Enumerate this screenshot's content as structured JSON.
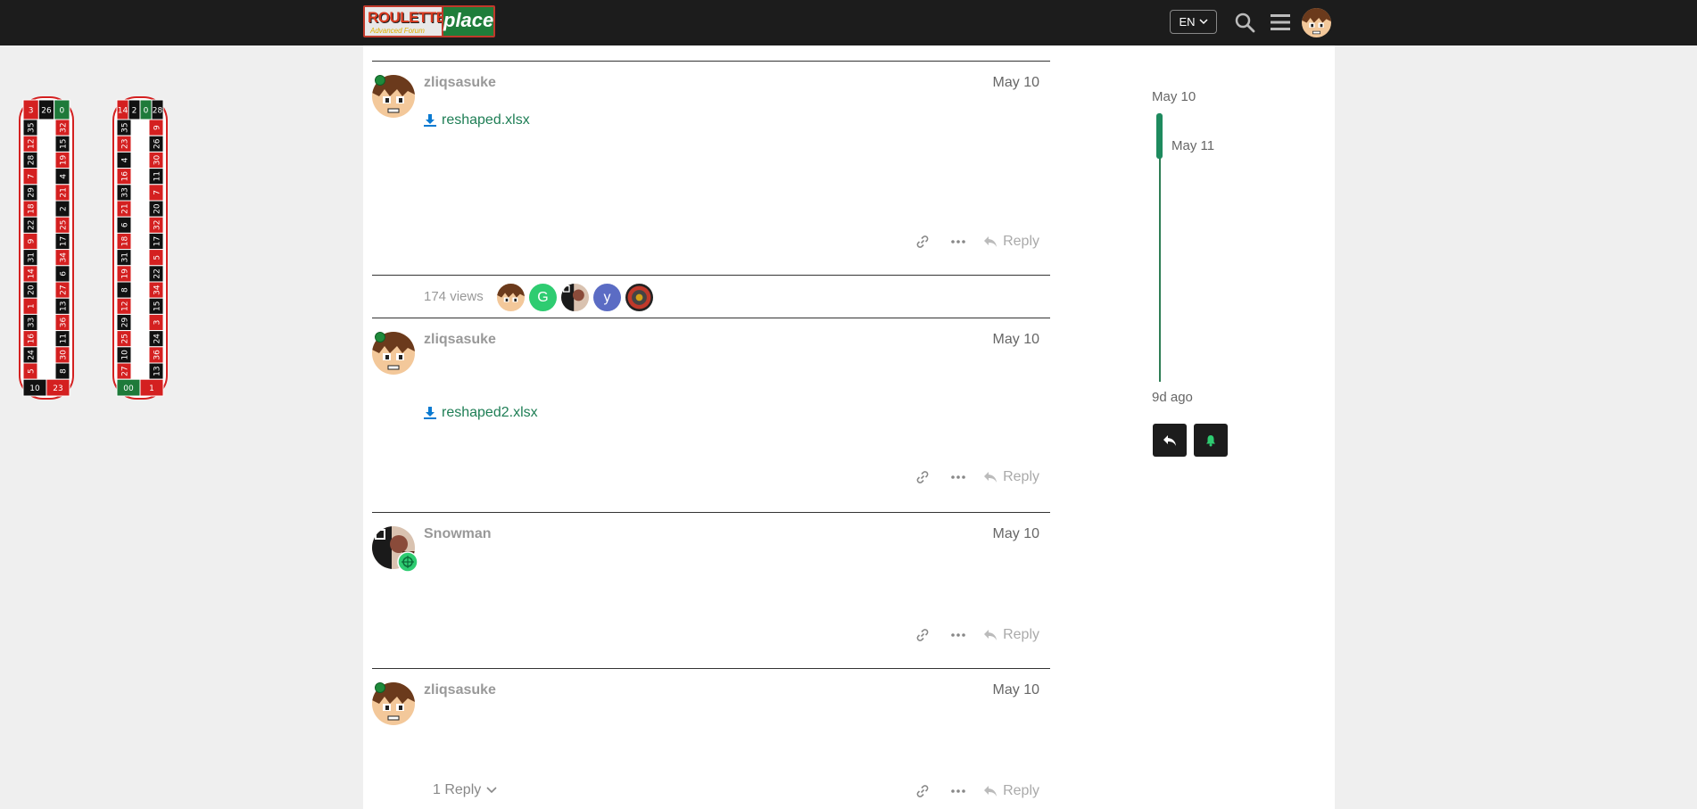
{
  "header": {
    "logo": {
      "word1": "ROULETTE",
      "word2": "place",
      "tagline": "Advanced Forum"
    },
    "language": "EN"
  },
  "topic_map": {
    "views": "174 views",
    "participants": [
      {
        "letter": "",
        "color": "#8a5a2b"
      },
      {
        "letter": "G",
        "color": "#2ecc71"
      },
      {
        "letter": "",
        "color": "#222222"
      },
      {
        "letter": "y",
        "color": "#5b6cc4"
      },
      {
        "letter": "",
        "color": "#c0392b"
      }
    ]
  },
  "posts": [
    {
      "username": "zliqsasuke",
      "date": "May 10",
      "attachment": "reshaped.xlsx",
      "reply_label": "Reply"
    },
    {
      "username": "zliqsasuke",
      "date": "May 10",
      "attachment": "reshaped2.xlsx",
      "reply_label": "Reply"
    },
    {
      "username": "Snowman",
      "date": "May 10",
      "reply_label": "Reply"
    },
    {
      "username": "zliqsasuke",
      "date": "May 10",
      "reply_label": "Reply",
      "replies_toggle": "1 Reply"
    }
  ],
  "timeline": {
    "start_date": "May 10",
    "current_date": "May 11",
    "end_date": "9d ago"
  },
  "wheel_left": {
    "top": [
      "3",
      "26",
      "0"
    ],
    "col_a": [
      "35",
      "12",
      "28",
      "7",
      "29",
      "18",
      "22",
      "9",
      "31",
      "14",
      "20",
      "1",
      "33",
      "16",
      "24",
      "5"
    ],
    "col_b": [
      "32",
      "15",
      "19",
      "4",
      "21",
      "2",
      "25",
      "17",
      "34",
      "6",
      "27",
      "13",
      "36",
      "11",
      "30",
      "8"
    ],
    "bottom": [
      "10",
      "23"
    ]
  },
  "wheel_right": {
    "top": [
      "14",
      "2",
      "0",
      "28"
    ],
    "col_a": [
      "35",
      "23",
      "4",
      "16",
      "33",
      "21",
      "6",
      "18",
      "31",
      "19",
      "8",
      "12",
      "29",
      "25",
      "10",
      "27"
    ],
    "col_b": [
      "9",
      "26",
      "30",
      "11",
      "7",
      "20",
      "32",
      "17",
      "5",
      "22",
      "34",
      "15",
      "3",
      "24",
      "36",
      "13"
    ],
    "bottom": [
      "00",
      "1"
    ]
  },
  "colors": {
    "accent": "#1e7e55",
    "header": "#1c1c1c",
    "red": "#d42020",
    "black": "#111111",
    "green": "#1e7a3a"
  }
}
